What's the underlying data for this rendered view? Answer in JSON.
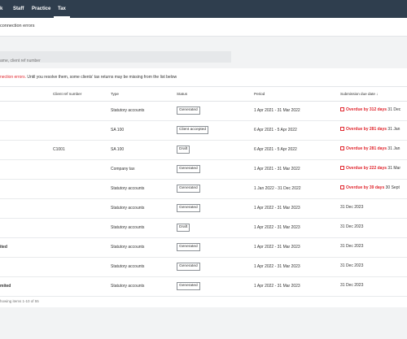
{
  "nav": {
    "items": [
      {
        "label": "k",
        "active": false
      },
      {
        "label": "Staff",
        "active": false
      },
      {
        "label": "Practice",
        "active": false
      },
      {
        "label": "Tax",
        "active": true
      }
    ]
  },
  "error_bar": {
    "text": "connection errors"
  },
  "search": {
    "placeholder": "ame, client ref number"
  },
  "warning": {
    "error_text": "nection errors.",
    "rest_text": " Until you resolve them, some clients' tax returns may be missing from the list below"
  },
  "table": {
    "headers": {
      "client_ref": "Client ref number",
      "type": "Type",
      "status": "Status",
      "period": "Period",
      "due": "Submission due date ↓"
    },
    "rows": [
      {
        "name": "",
        "ref": "",
        "type": "Statutory accounts",
        "status": "Generated",
        "period": "1 Apr 2021 - 31 Mar 2022",
        "overdue": "Overdue by 312 days",
        "due": "31 Dec"
      },
      {
        "name": "",
        "ref": "",
        "type": "SA 100",
        "status": "Client accepted",
        "period": "6 Apr 2021 - 5 Apr 2022",
        "overdue": "Overdue by 281 days",
        "due": "31 Jan"
      },
      {
        "name": "",
        "ref": "C1001",
        "type": "SA 100",
        "status": "Draft",
        "period": "6 Apr 2021 - 5 Apr 2022",
        "overdue": "Overdue by 281 days",
        "due": "31 Jan"
      },
      {
        "name": "",
        "ref": "",
        "type": "Company tax",
        "status": "Generated",
        "period": "1 Apr 2021 - 31 Mar 2022",
        "overdue": "Overdue by 222 days",
        "due": "31 Mar"
      },
      {
        "name": "",
        "ref": "",
        "type": "Statutory accounts",
        "status": "Generated",
        "period": "1 Jan 2022 - 31 Dec 2022",
        "overdue": "Overdue by 39 days",
        "due": "30 Sept"
      },
      {
        "name": "",
        "ref": "",
        "type": "Statutory accounts",
        "status": "Generated",
        "period": "1 Apr 2022 - 31 Mar 2023",
        "overdue": "",
        "due": "31 Dec 2023"
      },
      {
        "name": "",
        "ref": "",
        "type": "Statutory accounts",
        "status": "Draft",
        "period": "1 Apr 2022 - 31 Mar 2023",
        "overdue": "",
        "due": "31 Dec 2023"
      },
      {
        "name": "ited",
        "ref": "",
        "type": "Statutory accounts",
        "status": "Generated",
        "period": "1 Apr 2022 - 31 Mar 2023",
        "overdue": "",
        "due": "31 Dec 2023"
      },
      {
        "name": "",
        "ref": "",
        "type": "Statutory accounts",
        "status": "Generated",
        "period": "1 Apr 2022 - 31 Mar 2023",
        "overdue": "",
        "due": "31 Dec 2023"
      },
      {
        "name": "mited",
        "ref": "",
        "type": "Statutory accounts",
        "status": "Generated",
        "period": "1 Apr 2022 - 31 Mar 2023",
        "overdue": "",
        "due": "31 Dec 2023"
      }
    ]
  },
  "footer": {
    "text": "howing items 1-10 of 55"
  },
  "colors": {
    "topbar": "#2f3e4e",
    "error": "#e0262e",
    "background": "#f2f3f4"
  }
}
